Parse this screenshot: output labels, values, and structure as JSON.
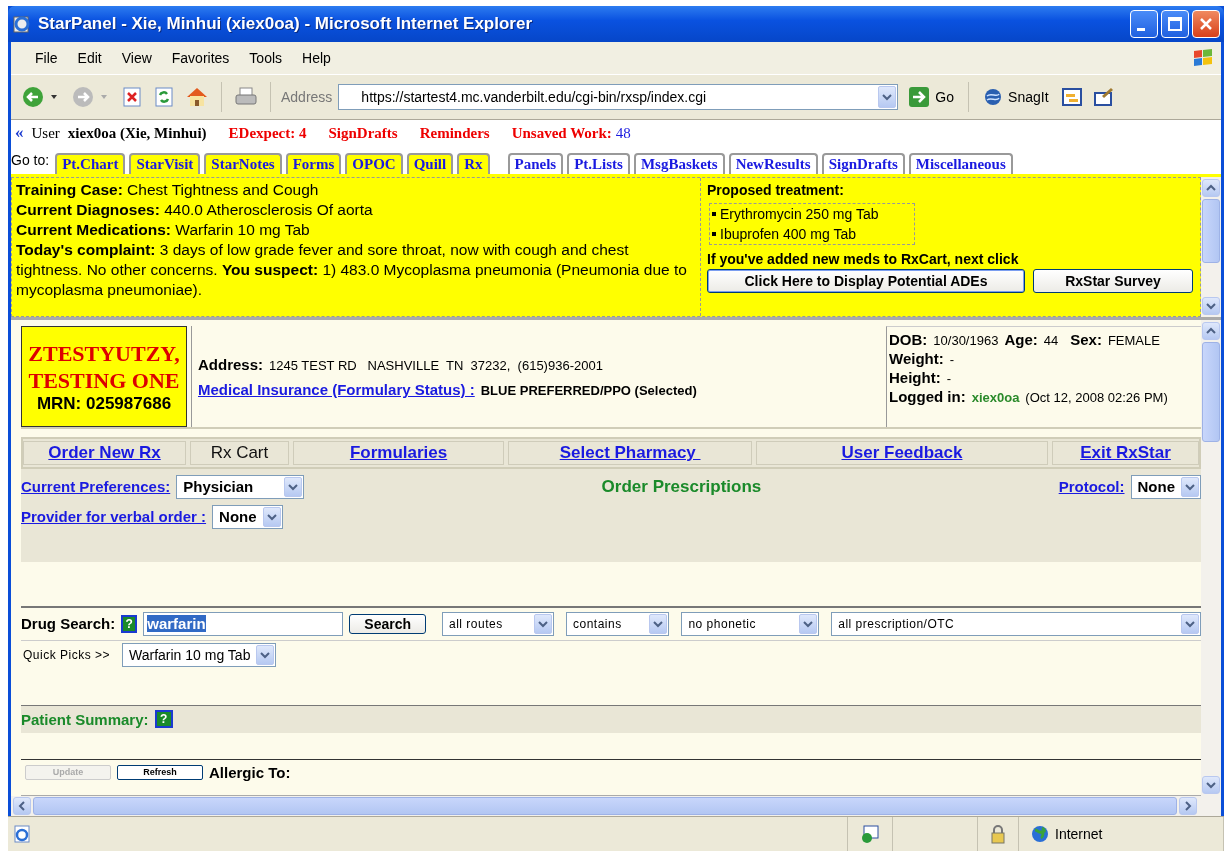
{
  "window": {
    "title": "StarPanel - Xie, Minhui (xiex0oa) - Microsoft Internet Explorer"
  },
  "menu": [
    "File",
    "Edit",
    "View",
    "Favorites",
    "Tools",
    "Help"
  ],
  "toolbar": {
    "address_label": "Address",
    "url": "https://startest4.mc.vanderbilt.edu/cgi-bin/rxsp/index.cgi",
    "go": "Go",
    "snagit": "SnagIt"
  },
  "user_bar": {
    "collapse": "«",
    "user_label": "User",
    "user": "xiex0oa (Xie, Minhui)",
    "alerts": [
      "EDexpect: 4",
      "SignDrafts",
      "Reminders"
    ],
    "unsaved_label": "Unsaved Work:",
    "unsaved_count": "48"
  },
  "goto": {
    "label": "Go to:",
    "tabs": [
      {
        "label": "Pt.Chart",
        "highlighted": true
      },
      {
        "label": "StarVisit",
        "highlighted": true
      },
      {
        "label": "StarNotes",
        "highlighted": true
      },
      {
        "label": "Forms",
        "highlighted": true
      },
      {
        "label": "OPOC",
        "highlighted": true
      },
      {
        "label": "Quill",
        "highlighted": true
      },
      {
        "label": "Rx",
        "highlighted": true
      },
      {
        "label": "Panels",
        "highlighted": false
      },
      {
        "label": "Pt.Lists",
        "highlighted": false
      },
      {
        "label": "MsgBaskets",
        "highlighted": false
      },
      {
        "label": "NewResults",
        "highlighted": false
      },
      {
        "label": "SignDrafts",
        "highlighted": false
      },
      {
        "label": "Miscellaneous",
        "highlighted": false
      }
    ]
  },
  "case": {
    "lines": [
      "**Training Case:** Chest Tightness and Cough",
      "**Current Diagnoses:** 440.0 Atherosclerosis Of aorta",
      "**Current Medications:** Warfarin 10 mg Tab",
      "**Today's complaint:** 3 days of low grade fever and sore throat, now with cough and chest tightness. No other concerns. **You suspect:** 1) 483.0 Mycoplasma pneumonia (Pneumonia due to mycoplasma pneumoniae)."
    ],
    "proposed_title": "Proposed treatment:",
    "proposed": [
      "Erythromycin 250 mg Tab",
      "Ibuprofen 400 mg Tab"
    ],
    "note": "If you've added new meds to RxCart, next click",
    "buttons": [
      "Click Here to Display Potential ADEs",
      "RxStar Survey"
    ]
  },
  "patient": {
    "name": "ZTESTYUTZY, TESTING ONE",
    "mrn": "MRN: 025987686",
    "address_label": "Address:",
    "address": "1245 TEST RD   NASHVILLE  TN  37232,  (615)936-2001",
    "insurance_link": "Medical Insurance (Formulary Status) :",
    "insurance": "BLUE PREFERRED/PPO (Selected)",
    "dob_label": "DOB:",
    "dob": "10/30/1963",
    "age_label": "Age:",
    "age": "44",
    "sex_label": "Sex:",
    "sex": "FEMALE",
    "weight_label": "Weight:",
    "weight": "-",
    "height_label": "Height:",
    "height": "-",
    "login_label": "Logged in:",
    "login_user": "xiex0oa",
    "login_time": "(Oct 12, 2008 02:26 PM)"
  },
  "nav_tabs": [
    {
      "label": "Order New Rx",
      "selected": false
    },
    {
      "label": "Rx Cart",
      "selected": true
    },
    {
      "label": "Formularies",
      "selected": false
    },
    {
      "label": "Select Pharmacy ",
      "selected": false
    },
    {
      "label": "User Feedback",
      "selected": false
    },
    {
      "label": "Exit RxStar",
      "selected": false
    }
  ],
  "preferences": {
    "current_label": "Current Preferences:",
    "current": "Physician",
    "provider_label": "Provider for verbal order :",
    "provider": "None",
    "title": "Order Prescriptions",
    "protocol_label": "Protocol:",
    "protocol": "None"
  },
  "drug_search": {
    "label": "Drug Search:",
    "help": "?",
    "value": "warfarin",
    "button": "Search",
    "filters": [
      "all routes",
      "contains",
      "no phonetic",
      "all prescription/OTC"
    ],
    "quick_label": "Quick Picks >>",
    "quick": "Warfarin 10 mg Tab"
  },
  "summary": {
    "title": "Patient Summary:",
    "help": "?",
    "buttons": [
      {
        "label": "Update",
        "disabled": true
      },
      {
        "label": "Refresh",
        "disabled": false
      }
    ],
    "allergy": "Allergic To:"
  },
  "status_bar": {
    "zone": "Internet"
  }
}
